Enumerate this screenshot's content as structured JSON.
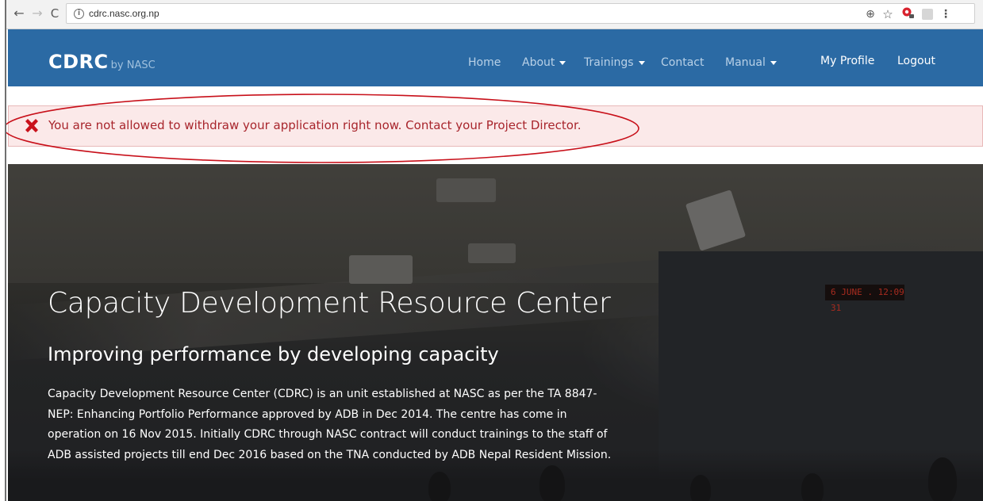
{
  "browser": {
    "url": "cdrc.nasc.org.np",
    "back_icon": "←",
    "forward_icon": "→",
    "reload_icon": "C",
    "info_icon": "i",
    "zoom_icon": "⊕",
    "star_icon": "☆",
    "menu_icon": "⋮"
  },
  "header": {
    "brand": "CDRC",
    "brand_sub": "by NASC",
    "color": "#2b6aa4",
    "nav": [
      {
        "label": "Home",
        "dropdown": false
      },
      {
        "label": "About",
        "dropdown": true
      },
      {
        "label": "Trainings",
        "dropdown": true
      },
      {
        "label": "Contact",
        "dropdown": false
      },
      {
        "label": "Manual",
        "dropdown": true
      }
    ],
    "account": {
      "profile": "My Profile",
      "logout": "Logout"
    }
  },
  "alert": {
    "message": "You are not allowed to withdraw your application right now. Contact your Project Director.",
    "color": "#a8252c",
    "background": "#fbe9e9"
  },
  "hero": {
    "clock": "6 JUNE . 12:09 31",
    "title": "Capacity Development Resource Center",
    "subtitle": "Improving performance by developing capacity",
    "body": "Capacity Development Resource Center (CDRC) is an unit established at NASC as per the TA 8847-NEP: Enhancing Portfolio Performance approved by ADB in Dec 2014. The centre has come in operation on 16 Nov 2015. Initially CDRC through NASC contract will conduct trainings to the staff of ADB assisted projects till end Dec 2016 based on the TNA conducted by ADB Nepal Resident Mission."
  }
}
